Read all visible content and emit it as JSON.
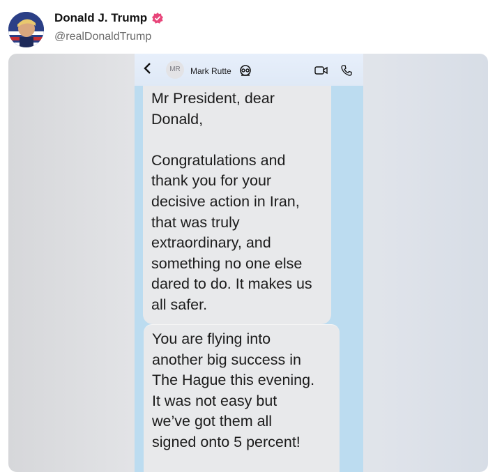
{
  "post": {
    "author_name": "Donald J. Trump",
    "author_handle": "@realDonaldTrump",
    "avatar_icon": "profile-photo-icon",
    "verified_icon": "verified-badge-icon",
    "verified_color": "#e8457a"
  },
  "screenshot": {
    "contact_initials": "MR",
    "contact_name": "Mark Rutte",
    "icons": [
      "back-chevron-icon",
      "hidden-contact-icon",
      "video-call-icon",
      "phone-call-icon"
    ],
    "messages": [
      "Mr President, dear\nDonald,\n\nCongratulations and\nthank you for your\ndecisive action in Iran,\nthat was truly\nextraordinary, and\nsomething no one else\ndared to do.  It makes us\nall safer.",
      "You are flying into\nanother big success in\nThe Hague this evening.\nIt was not easy but\nwe’ve got them all\nsigned onto 5 percent!"
    ]
  }
}
